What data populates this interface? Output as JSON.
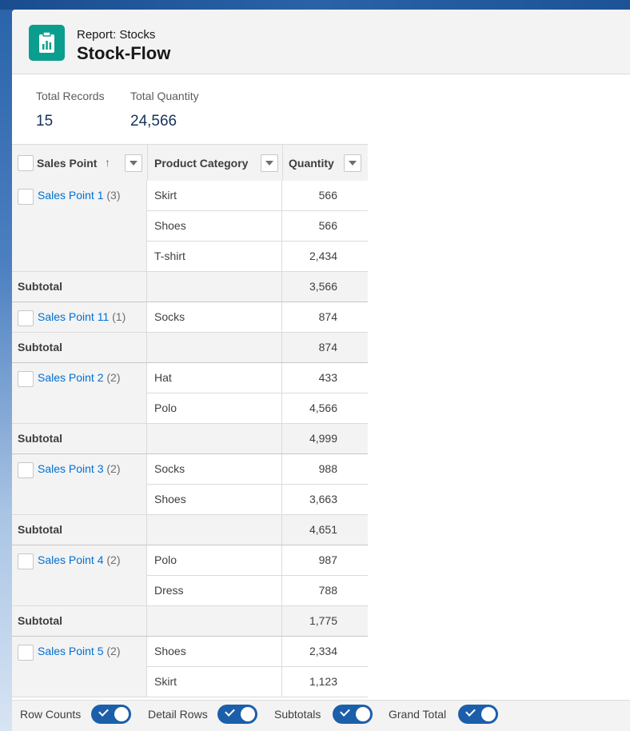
{
  "header": {
    "subtitle": "Report: Stocks",
    "title": "Stock-Flow"
  },
  "stats": {
    "total_records_label": "Total Records",
    "total_records_value": "15",
    "total_quantity_label": "Total Quantity",
    "total_quantity_value": "24,566"
  },
  "table": {
    "columns": {
      "sales_point": "Sales Point",
      "sort_indicator": "↑",
      "product_category": "Product Category",
      "quantity": "Quantity"
    },
    "subtotal_label": "Subtotal",
    "groups": [
      {
        "name": "Sales Point 1",
        "count": "(3)",
        "rows": [
          {
            "category": "Skirt",
            "quantity": "566"
          },
          {
            "category": "Shoes",
            "quantity": "566"
          },
          {
            "category": "T-shirt",
            "quantity": "2,434"
          }
        ],
        "subtotal": "3,566"
      },
      {
        "name": "Sales Point 11",
        "count": "(1)",
        "rows": [
          {
            "category": "Socks",
            "quantity": "874"
          }
        ],
        "subtotal": "874"
      },
      {
        "name": "Sales Point 2",
        "count": "(2)",
        "rows": [
          {
            "category": "Hat",
            "quantity": "433"
          },
          {
            "category": "Polo",
            "quantity": "4,566"
          }
        ],
        "subtotal": "4,999"
      },
      {
        "name": "Sales Point 3",
        "count": "(2)",
        "rows": [
          {
            "category": "Socks",
            "quantity": "988"
          },
          {
            "category": "Shoes",
            "quantity": "3,663"
          }
        ],
        "subtotal": "4,651"
      },
      {
        "name": "Sales Point 4",
        "count": "(2)",
        "rows": [
          {
            "category": "Polo",
            "quantity": "987"
          },
          {
            "category": "Dress",
            "quantity": "788"
          }
        ],
        "subtotal": "1,775"
      },
      {
        "name": "Sales Point 5",
        "count": "(2)",
        "rows": [
          {
            "category": "Shoes",
            "quantity": "2,334"
          },
          {
            "category": "Skirt",
            "quantity": "1,123"
          }
        ],
        "subtotal": null
      }
    ]
  },
  "footer": {
    "toggles": [
      {
        "label": "Row Counts",
        "on": true
      },
      {
        "label": "Detail Rows",
        "on": true
      },
      {
        "label": "Subtotals",
        "on": true
      },
      {
        "label": "Grand Total",
        "on": true
      }
    ]
  },
  "colors": {
    "accent": "#0b9e8e",
    "link": "#0070d2",
    "toggle": "#1b5faa"
  }
}
